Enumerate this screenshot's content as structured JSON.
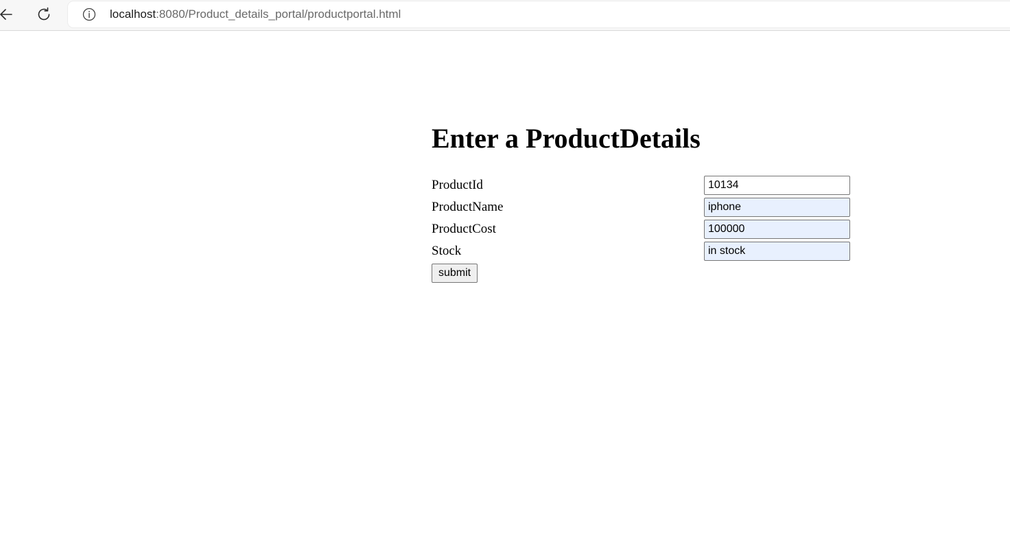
{
  "browser": {
    "url_host": "localhost",
    "url_path": ":8080/Product_details_portal/productportal.html",
    "icons": {
      "back": "arrow-left-icon",
      "reload": "reload-icon",
      "info": "info-icon"
    }
  },
  "page": {
    "title": "Enter a ProductDetails"
  },
  "form": {
    "fields": [
      {
        "label": "ProductId",
        "value": "10134"
      },
      {
        "label": "ProductName",
        "value": "iphone"
      },
      {
        "label": "ProductCost",
        "value": "100000"
      },
      {
        "label": "Stock",
        "value": "in stock"
      }
    ],
    "submit_label": "submit"
  },
  "colors": {
    "autofill_background": "#e8f0fe",
    "button_background": "#efefef",
    "input_border": "#767676"
  }
}
